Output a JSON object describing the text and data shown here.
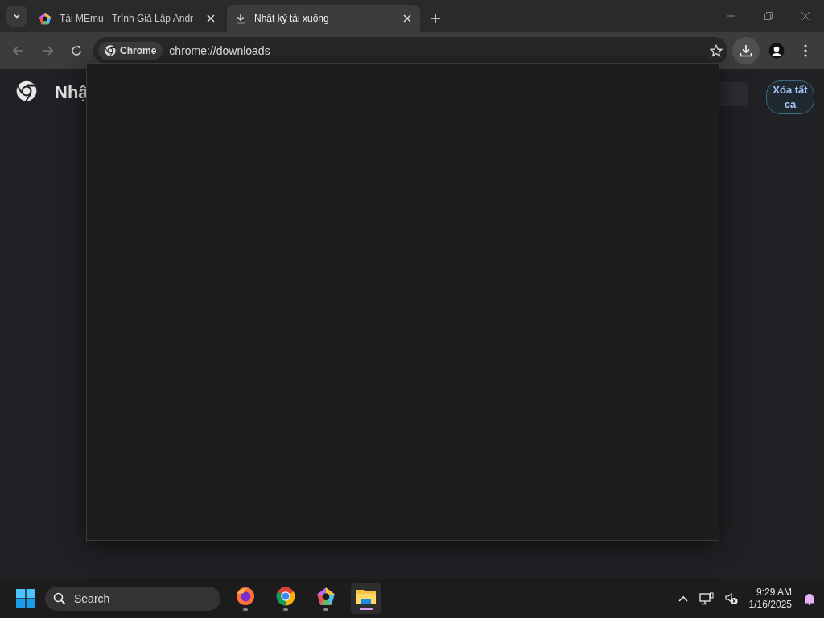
{
  "tab_strip": {
    "tabs": [
      {
        "kind": "site",
        "title": "Tải MEmu - Trình Giả Lập Andr",
        "selected": false
      },
      {
        "kind": "download",
        "title": "Nhật ký tải xuống",
        "selected": true
      }
    ]
  },
  "toolbar": {
    "site_chip": "Chrome",
    "url": "chrome://downloads"
  },
  "page": {
    "title": "Nhậ",
    "clear_button": "Xóa tất cả"
  },
  "taskbar": {
    "search": {
      "placeholder": "Search"
    },
    "apps": [
      {
        "kind": "firefox",
        "selected": false
      },
      {
        "kind": "chrome",
        "selected": false
      },
      {
        "kind": "memu",
        "selected": false
      },
      {
        "kind": "folder",
        "selected": true
      }
    ],
    "time": "9:29 AM",
    "date": "1/16/2025"
  }
}
